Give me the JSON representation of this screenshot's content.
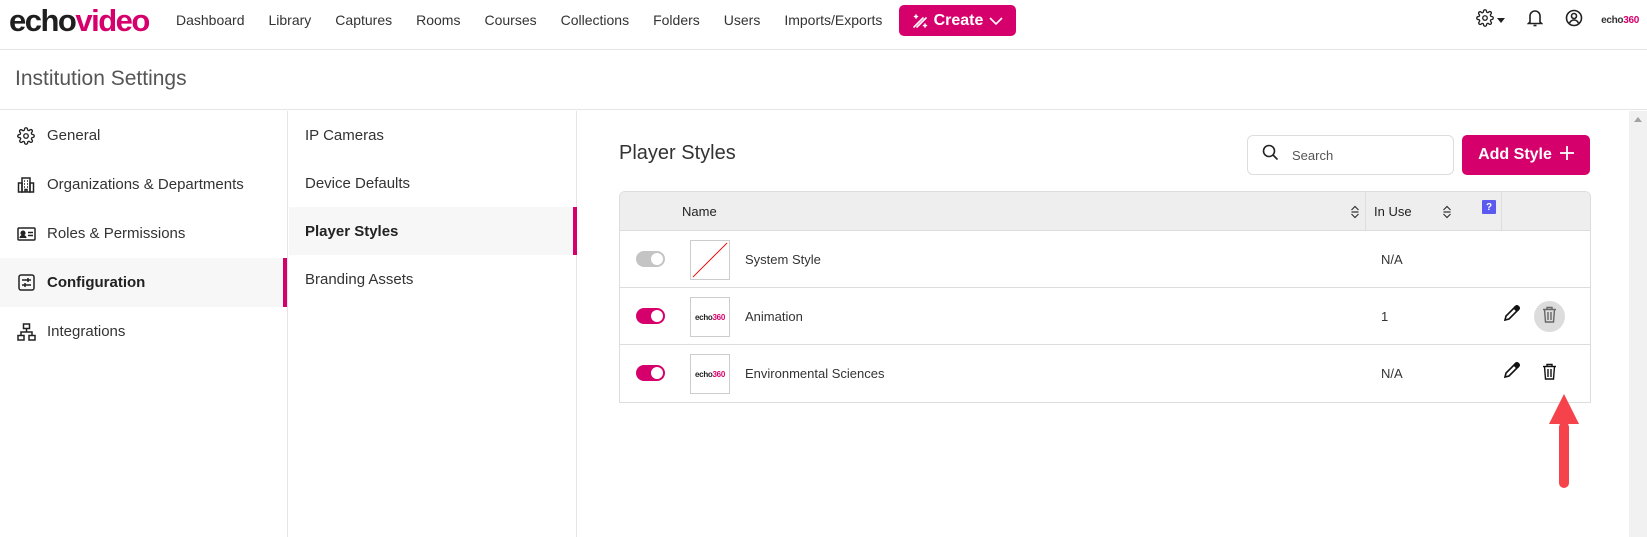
{
  "app": {
    "logo_primary": "echo",
    "logo_accent": "video",
    "brand_color": "#d6006c",
    "partner_logo_primary": "echo",
    "partner_logo_accent": "360"
  },
  "nav": {
    "items": [
      {
        "label": "Dashboard"
      },
      {
        "label": "Library"
      },
      {
        "label": "Captures"
      },
      {
        "label": "Rooms"
      },
      {
        "label": "Courses"
      },
      {
        "label": "Collections"
      },
      {
        "label": "Folders"
      },
      {
        "label": "Users"
      },
      {
        "label": "Imports/Exports"
      }
    ],
    "create_label": "Create",
    "icons": [
      "settings-icon",
      "bell-icon",
      "user-account-icon"
    ]
  },
  "page": {
    "title": "Institution Settings"
  },
  "sidebar": {
    "items": [
      {
        "label": "General",
        "icon": "gear-icon",
        "active": false
      },
      {
        "label": "Organizations & Departments",
        "icon": "building-icon",
        "active": false
      },
      {
        "label": "Roles & Permissions",
        "icon": "id-card-icon",
        "active": false
      },
      {
        "label": "Configuration",
        "icon": "sliders-icon",
        "active": true
      },
      {
        "label": "Integrations",
        "icon": "network-icon",
        "active": false
      }
    ]
  },
  "subnav": {
    "items": [
      {
        "label": "IP Cameras",
        "active": false
      },
      {
        "label": "Device Defaults",
        "active": false
      },
      {
        "label": "Player Styles",
        "active": true
      },
      {
        "label": "Branding Assets",
        "active": false
      }
    ]
  },
  "main": {
    "title": "Player Styles",
    "search_placeholder": "Search",
    "search_value": "",
    "add_button_label": "Add Style",
    "table": {
      "columns": {
        "name": "Name",
        "in_use": "In Use",
        "help": "?"
      },
      "rows": [
        {
          "name": "System Style",
          "in_use": "N/A",
          "enabled": true,
          "toggle_disabled": true,
          "thumbnail": "none",
          "editable": false,
          "deletable": false
        },
        {
          "name": "Animation",
          "in_use": "1",
          "enabled": true,
          "toggle_disabled": false,
          "thumbnail": "echo360-logo",
          "editable": true,
          "deletable": true,
          "delete_hovered": true
        },
        {
          "name": "Environmental Sciences",
          "in_use": "N/A",
          "enabled": true,
          "toggle_disabled": false,
          "thumbnail": "echo360-logo",
          "editable": true,
          "deletable": true
        }
      ]
    }
  },
  "annotation": {
    "type": "arrow",
    "color": "#f5424b",
    "target": "delete-button (Environmental Sciences)"
  }
}
